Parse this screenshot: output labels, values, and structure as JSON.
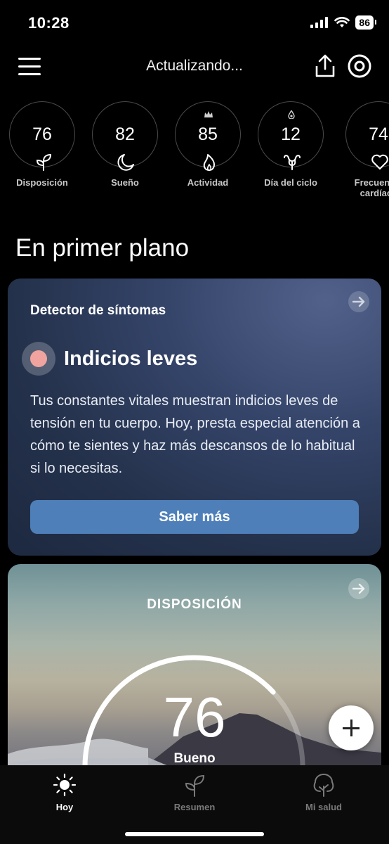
{
  "status_bar": {
    "time": "10:28",
    "battery": "86"
  },
  "header": {
    "title": "Actualizando..."
  },
  "scores": [
    {
      "value": "76",
      "label": "Disposición",
      "icon": "sprout-icon"
    },
    {
      "value": "82",
      "label": "Sueño",
      "icon": "moon-icon"
    },
    {
      "value": "85",
      "label": "Actividad",
      "icon": "flame-icon",
      "badge": "crown-icon"
    },
    {
      "value": "12",
      "label": "Día del ciclo",
      "icon": "uterus-icon",
      "badge": "drop-icon"
    },
    {
      "value": "74",
      "label": "Frecuencia cardíaca",
      "icon": "heart-icon"
    }
  ],
  "section_title": "En primer plano",
  "symptom_card": {
    "title": "Detector de síntomas",
    "indicator_title": "Indicios leves",
    "indicator_color": "#f1a3a0",
    "text": "Tus constantes vitales muestran indicios leves de tensión en tu cuerpo. Hoy, presta especial atención a cómo te sientes y haz más descansos de lo habitual si lo necesitas.",
    "button": "Saber más"
  },
  "disposition_card": {
    "label": "DISPOSICIÓN",
    "value": "76",
    "status": "Bueno",
    "gauge_fraction": 0.76
  },
  "bottom_nav": [
    {
      "label": "Hoy",
      "icon": "sun-icon",
      "active": true
    },
    {
      "label": "Resumen",
      "icon": "sprout-icon",
      "active": false
    },
    {
      "label": "Mi salud",
      "icon": "tree-icon",
      "active": false
    }
  ]
}
